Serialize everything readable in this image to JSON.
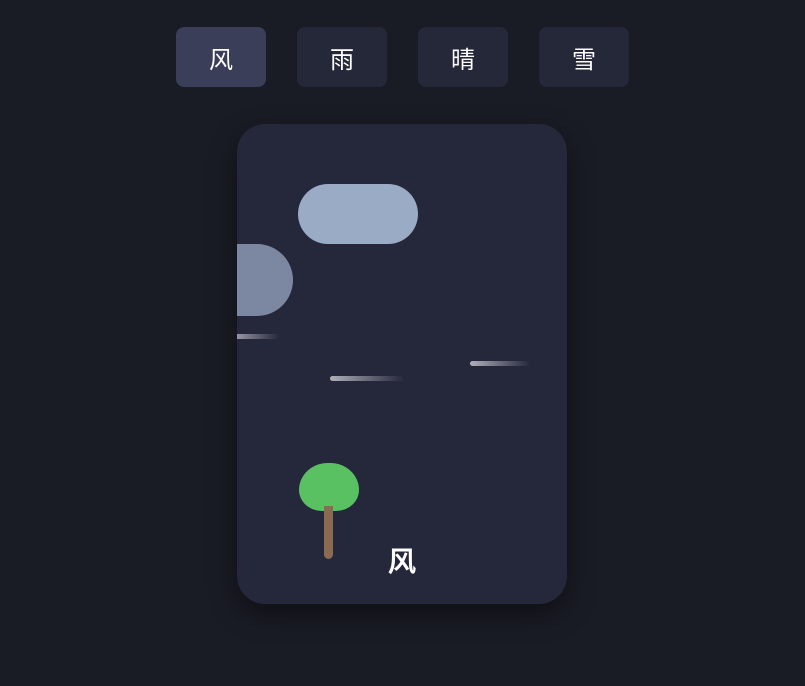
{
  "tabs": [
    {
      "label": "风",
      "active": true
    },
    {
      "label": "雨",
      "active": false
    },
    {
      "label": "晴",
      "active": false
    },
    {
      "label": "雪",
      "active": false
    }
  ],
  "card": {
    "label": "风"
  },
  "colors": {
    "background": "#1a1c25",
    "tab_bg": "#252839",
    "tab_active_bg": "#3a3e58",
    "card_bg": "#25273b",
    "cloud_light": "#9aabc6",
    "cloud_dark": "#7c88a1",
    "leaf": "#5ac163",
    "trunk": "#8a6b52"
  }
}
